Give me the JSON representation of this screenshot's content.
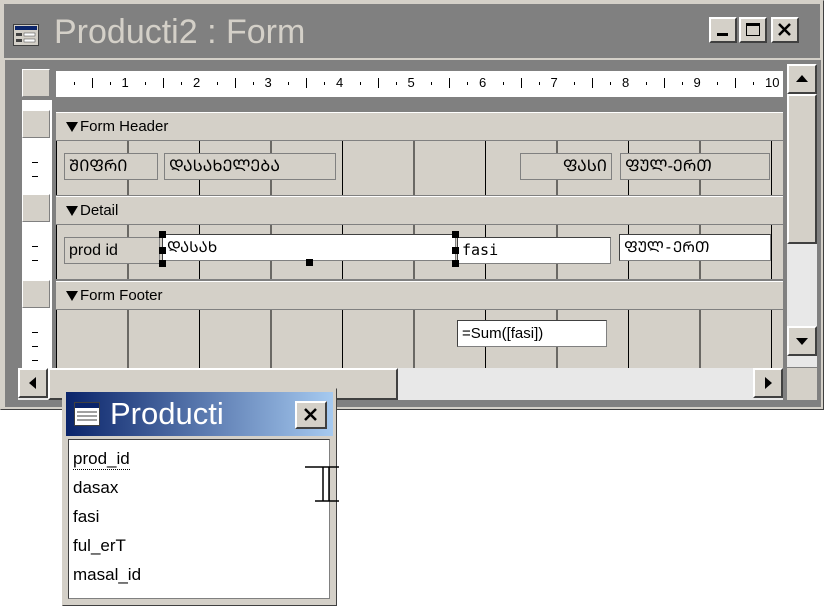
{
  "window": {
    "title": "Producti2 : Form",
    "minimize_label": "_",
    "maximize_label": "□",
    "close_label": "×"
  },
  "ruler": {
    "marks": [
      "1",
      "2",
      "3",
      "4",
      "5",
      "6",
      "7",
      "8",
      "9",
      "10"
    ]
  },
  "sections": {
    "header": {
      "label": "Form Header",
      "labels": [
        "ᲨᲘᲤᲠᲘ",
        "ᲓᲐᲡᲐᲮᲔᲚᲔᲑᲐ",
        "ᲤᲐᲡᲘ",
        "ᲤᲣᲚ-ᲔᲠᲗ"
      ]
    },
    "detail": {
      "label": "Detail",
      "controls": [
        "prod id",
        "ᲓᲐᲡᲐᲮ",
        "fasi",
        "ᲤᲣᲚ-ᲔᲠᲗ"
      ]
    },
    "footer": {
      "label": "Form Footer",
      "sum_control": "=Sum([fasi])"
    }
  },
  "field_list": {
    "title": "Producti",
    "close_label": "×",
    "fields": [
      "prod_id",
      "dasax",
      "fasi",
      "ful_erT",
      "masal_id"
    ]
  }
}
